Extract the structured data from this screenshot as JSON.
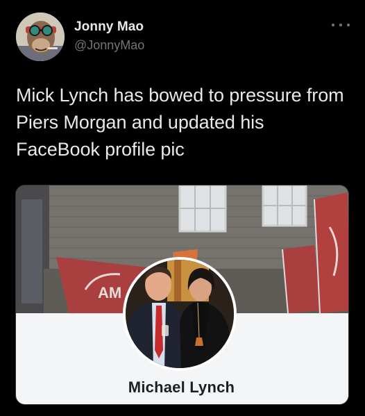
{
  "tweet": {
    "author": {
      "display_name": "Jonny Mao",
      "handle": "@JonnyMao",
      "avatar_icon": "ape-avatar-icon"
    },
    "more_icon": "more-horizontal-icon",
    "text": "Mick Lynch has bowed to pressure from Piers Morgan and updated his FaceBook profile pic",
    "media": {
      "facebook_profile_name": "Michael Lynch",
      "banner_text": "AM"
    }
  },
  "colors": {
    "background": "#000000",
    "text_primary": "#e7e9ea",
    "text_secondary": "#71767b",
    "facebook_panel": "#f4f5f7",
    "facebook_name": "#1c1e21",
    "flag_red": "#b2403f"
  }
}
